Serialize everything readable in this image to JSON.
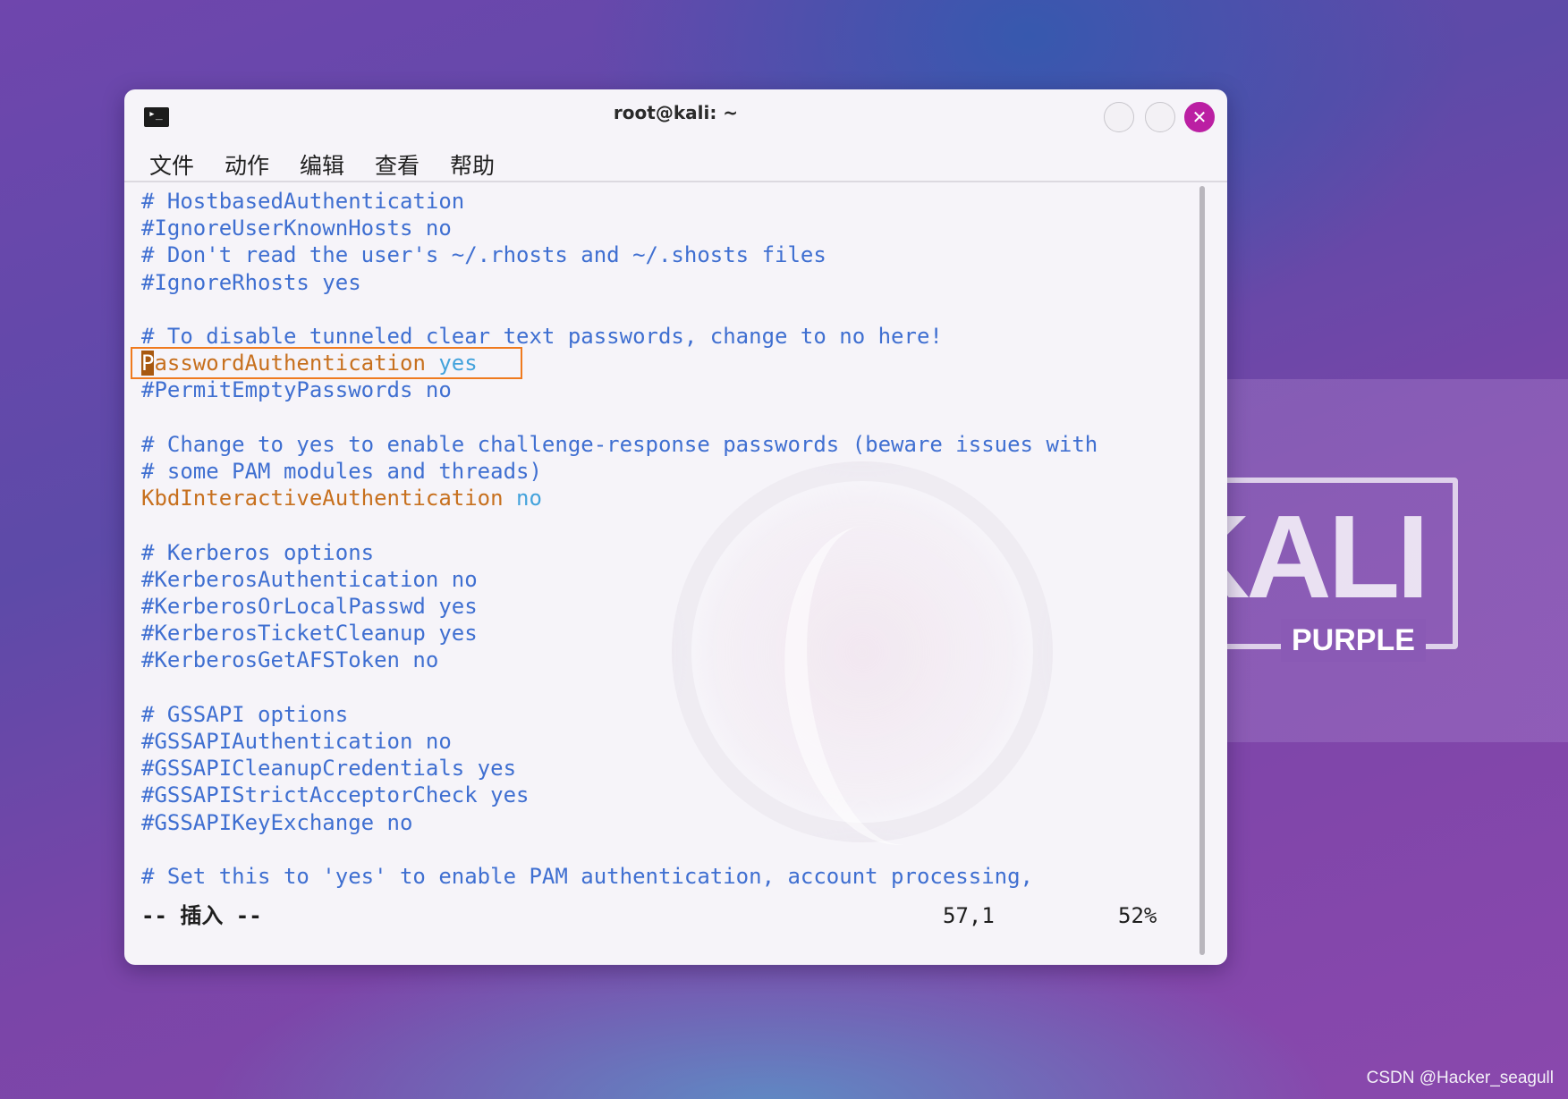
{
  "window": {
    "title": "root@kali: ~",
    "close_glyph": "✕",
    "terminal_icon_glyph": "▸_"
  },
  "menu": [
    "文件",
    "动作",
    "编辑",
    "查看",
    "帮助"
  ],
  "editor": {
    "lines": [
      {
        "text": "# HostbasedAuthentication",
        "kind": "comment"
      },
      {
        "text": "#IgnoreUserKnownHosts no",
        "kind": "comment"
      },
      {
        "text": "# Don't read the user's ~/.rhosts and ~/.shosts files",
        "kind": "comment"
      },
      {
        "text": "#IgnoreRhosts yes",
        "kind": "comment"
      },
      {
        "text": "",
        "kind": "blank"
      },
      {
        "text": "# To disable tunneled clear text passwords, change to no here!",
        "kind": "comment"
      },
      {
        "key": "PasswordAuthentication",
        "value": "yes",
        "kind": "directive",
        "highlighted": true,
        "cursor_char": "P"
      },
      {
        "text": "#PermitEmptyPasswords no",
        "kind": "comment"
      },
      {
        "text": "",
        "kind": "blank"
      },
      {
        "text": "# Change to yes to enable challenge-response passwords (beware issues with",
        "kind": "comment"
      },
      {
        "text": "# some PAM modules and threads)",
        "kind": "comment"
      },
      {
        "key": "KbdInteractiveAuthentication",
        "value": "no",
        "kind": "directive"
      },
      {
        "text": "",
        "kind": "blank"
      },
      {
        "text": "# Kerberos options",
        "kind": "comment"
      },
      {
        "text": "#KerberosAuthentication no",
        "kind": "comment"
      },
      {
        "text": "#KerberosOrLocalPasswd yes",
        "kind": "comment"
      },
      {
        "text": "#KerberosTicketCleanup yes",
        "kind": "comment"
      },
      {
        "text": "#KerberosGetAFSToken no",
        "kind": "comment"
      },
      {
        "text": "",
        "kind": "blank"
      },
      {
        "text": "# GSSAPI options",
        "kind": "comment"
      },
      {
        "text": "#GSSAPIAuthentication no",
        "kind": "comment"
      },
      {
        "text": "#GSSAPICleanupCredentials yes",
        "kind": "comment"
      },
      {
        "text": "#GSSAPIStrictAcceptorCheck yes",
        "kind": "comment"
      },
      {
        "text": "#GSSAPIKeyExchange no",
        "kind": "comment"
      },
      {
        "text": "",
        "kind": "blank"
      },
      {
        "text": "# Set this to 'yes' to enable PAM authentication, account processing,",
        "kind": "comment"
      }
    ],
    "status": {
      "mode": "-- 插入 --",
      "position": "57,1",
      "percent": "52%"
    }
  },
  "wallpaper": {
    "logo_main": "KALI",
    "logo_sub": "PURPLE"
  },
  "watermark": "CSDN @Hacker_seagull",
  "colors": {
    "comment": "#3f6fd1",
    "directive_key": "#c7701e",
    "directive_value": "#44a3dc",
    "highlight_border": "#ef7a1e",
    "close_button": "#bb1fa3"
  }
}
